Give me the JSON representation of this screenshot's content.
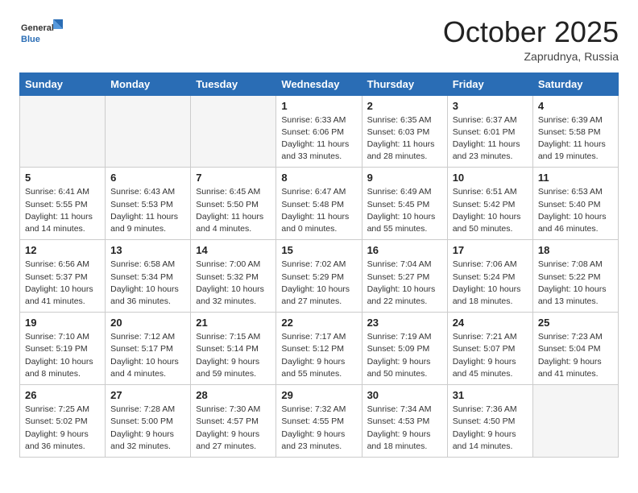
{
  "header": {
    "logo_general": "General",
    "logo_blue": "Blue",
    "title": "October 2025",
    "location": "Zaprudnya, Russia"
  },
  "weekdays": [
    "Sunday",
    "Monday",
    "Tuesday",
    "Wednesday",
    "Thursday",
    "Friday",
    "Saturday"
  ],
  "weeks": [
    [
      {
        "day": "",
        "empty": true
      },
      {
        "day": "",
        "empty": true
      },
      {
        "day": "",
        "empty": true
      },
      {
        "day": "1",
        "sunrise": "6:33 AM",
        "sunset": "6:06 PM",
        "daylight": "11 hours and 33 minutes."
      },
      {
        "day": "2",
        "sunrise": "6:35 AM",
        "sunset": "6:03 PM",
        "daylight": "11 hours and 28 minutes."
      },
      {
        "day": "3",
        "sunrise": "6:37 AM",
        "sunset": "6:01 PM",
        "daylight": "11 hours and 23 minutes."
      },
      {
        "day": "4",
        "sunrise": "6:39 AM",
        "sunset": "5:58 PM",
        "daylight": "11 hours and 19 minutes."
      }
    ],
    [
      {
        "day": "5",
        "sunrise": "6:41 AM",
        "sunset": "5:55 PM",
        "daylight": "11 hours and 14 minutes."
      },
      {
        "day": "6",
        "sunrise": "6:43 AM",
        "sunset": "5:53 PM",
        "daylight": "11 hours and 9 minutes."
      },
      {
        "day": "7",
        "sunrise": "6:45 AM",
        "sunset": "5:50 PM",
        "daylight": "11 hours and 4 minutes."
      },
      {
        "day": "8",
        "sunrise": "6:47 AM",
        "sunset": "5:48 PM",
        "daylight": "11 hours and 0 minutes."
      },
      {
        "day": "9",
        "sunrise": "6:49 AM",
        "sunset": "5:45 PM",
        "daylight": "10 hours and 55 minutes."
      },
      {
        "day": "10",
        "sunrise": "6:51 AM",
        "sunset": "5:42 PM",
        "daylight": "10 hours and 50 minutes."
      },
      {
        "day": "11",
        "sunrise": "6:53 AM",
        "sunset": "5:40 PM",
        "daylight": "10 hours and 46 minutes."
      }
    ],
    [
      {
        "day": "12",
        "sunrise": "6:56 AM",
        "sunset": "5:37 PM",
        "daylight": "10 hours and 41 minutes."
      },
      {
        "day": "13",
        "sunrise": "6:58 AM",
        "sunset": "5:34 PM",
        "daylight": "10 hours and 36 minutes."
      },
      {
        "day": "14",
        "sunrise": "7:00 AM",
        "sunset": "5:32 PM",
        "daylight": "10 hours and 32 minutes."
      },
      {
        "day": "15",
        "sunrise": "7:02 AM",
        "sunset": "5:29 PM",
        "daylight": "10 hours and 27 minutes."
      },
      {
        "day": "16",
        "sunrise": "7:04 AM",
        "sunset": "5:27 PM",
        "daylight": "10 hours and 22 minutes."
      },
      {
        "day": "17",
        "sunrise": "7:06 AM",
        "sunset": "5:24 PM",
        "daylight": "10 hours and 18 minutes."
      },
      {
        "day": "18",
        "sunrise": "7:08 AM",
        "sunset": "5:22 PM",
        "daylight": "10 hours and 13 minutes."
      }
    ],
    [
      {
        "day": "19",
        "sunrise": "7:10 AM",
        "sunset": "5:19 PM",
        "daylight": "10 hours and 8 minutes."
      },
      {
        "day": "20",
        "sunrise": "7:12 AM",
        "sunset": "5:17 PM",
        "daylight": "10 hours and 4 minutes."
      },
      {
        "day": "21",
        "sunrise": "7:15 AM",
        "sunset": "5:14 PM",
        "daylight": "9 hours and 59 minutes."
      },
      {
        "day": "22",
        "sunrise": "7:17 AM",
        "sunset": "5:12 PM",
        "daylight": "9 hours and 55 minutes."
      },
      {
        "day": "23",
        "sunrise": "7:19 AM",
        "sunset": "5:09 PM",
        "daylight": "9 hours and 50 minutes."
      },
      {
        "day": "24",
        "sunrise": "7:21 AM",
        "sunset": "5:07 PM",
        "daylight": "9 hours and 45 minutes."
      },
      {
        "day": "25",
        "sunrise": "7:23 AM",
        "sunset": "5:04 PM",
        "daylight": "9 hours and 41 minutes."
      }
    ],
    [
      {
        "day": "26",
        "sunrise": "7:25 AM",
        "sunset": "5:02 PM",
        "daylight": "9 hours and 36 minutes."
      },
      {
        "day": "27",
        "sunrise": "7:28 AM",
        "sunset": "5:00 PM",
        "daylight": "9 hours and 32 minutes."
      },
      {
        "day": "28",
        "sunrise": "7:30 AM",
        "sunset": "4:57 PM",
        "daylight": "9 hours and 27 minutes."
      },
      {
        "day": "29",
        "sunrise": "7:32 AM",
        "sunset": "4:55 PM",
        "daylight": "9 hours and 23 minutes."
      },
      {
        "day": "30",
        "sunrise": "7:34 AM",
        "sunset": "4:53 PM",
        "daylight": "9 hours and 18 minutes."
      },
      {
        "day": "31",
        "sunrise": "7:36 AM",
        "sunset": "4:50 PM",
        "daylight": "9 hours and 14 minutes."
      },
      {
        "day": "",
        "empty": true
      }
    ]
  ],
  "labels": {
    "sunrise": "Sunrise:",
    "sunset": "Sunset:",
    "daylight": "Daylight hours"
  }
}
